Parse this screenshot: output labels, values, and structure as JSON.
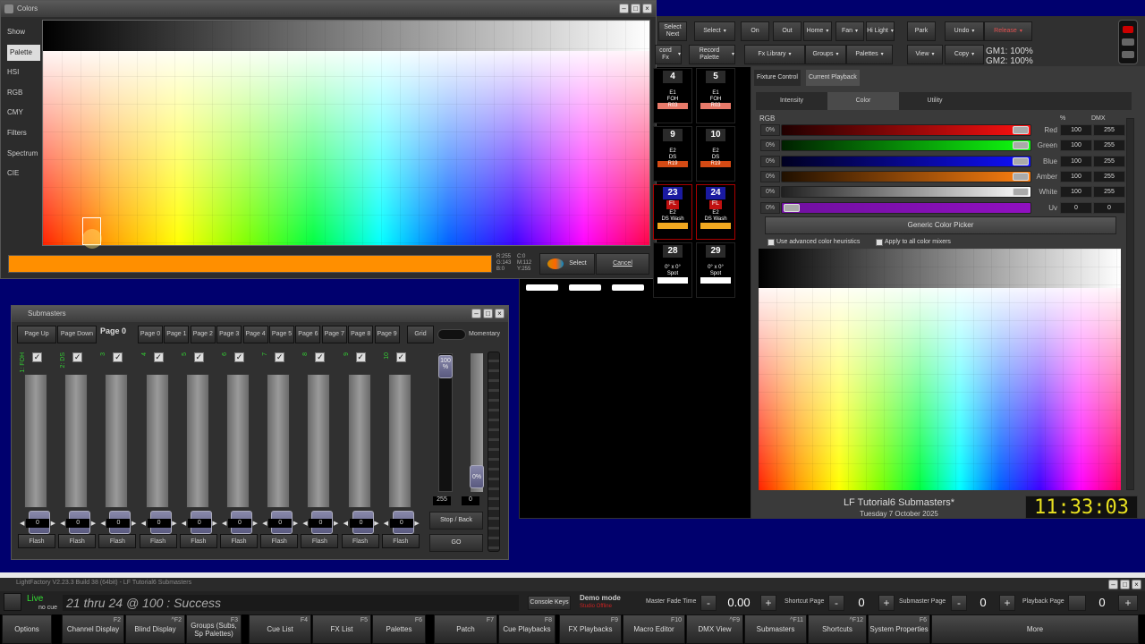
{
  "colors_window": {
    "title": "Colors",
    "sidebar": [
      "Show",
      "Palette",
      "HSI",
      "RGB",
      "CMY",
      "Filters",
      "Spectrum",
      "CIE"
    ],
    "selected_tab": "Palette",
    "readout": {
      "r": "R:255",
      "g": "G:143",
      "b": "B:0",
      "c": "C:0",
      "m": "M:112",
      "y": "Y:255"
    },
    "select_label": "Select",
    "cancel_label": "Cancel",
    "swatch_color": "#ff8f00"
  },
  "toolbar": {
    "row1": [
      {
        "label": "Select Next"
      },
      {
        "label": "Select",
        "drop": true
      },
      {
        "label": "On"
      },
      {
        "label": "Out"
      },
      {
        "label": "Home",
        "drop": true
      },
      {
        "label": "Fan",
        "drop": true
      },
      {
        "label": "Hi Light",
        "drop": true
      },
      {
        "label": "Park"
      },
      {
        "label": "Undo",
        "drop": true
      },
      {
        "label": "Release",
        "drop": true
      }
    ],
    "row2": [
      {
        "label": "cord Fx",
        "drop": true
      },
      {
        "label": "Record Palette",
        "drop": true
      },
      {
        "label": "Fx Library",
        "drop": true
      },
      {
        "label": "Groups",
        "drop": true
      },
      {
        "label": "Palettes",
        "drop": true
      },
      {
        "label": "View",
        "drop": true
      },
      {
        "label": "Copy",
        "drop": true
      }
    ],
    "gm1": "GM1: 100%",
    "gm2": "GM2: 100%"
  },
  "fixtures": [
    {
      "num": "4",
      "line1": "E1",
      "line2": "FOH",
      "tag": "R03",
      "tagcolor": "#e87a6a"
    },
    {
      "num": "5",
      "line1": "E1",
      "line2": "FOH",
      "tag": "R03",
      "tagcolor": "#e87a6a"
    },
    {
      "num": "9",
      "line1": "E2",
      "line2": "DS",
      "tag": "R19",
      "tagcolor": "#d44a14"
    },
    {
      "num": "10",
      "line1": "E2",
      "line2": "DS",
      "tag": "R19",
      "tagcolor": "#d44a14"
    },
    {
      "num": "23",
      "fl": "FL",
      "line1": "E2",
      "line2": "DS Wash",
      "tag": "",
      "tagcolor": "#f0a820"
    },
    {
      "num": "24",
      "fl": "FL",
      "line1": "E2",
      "line2": "DS Wash",
      "tag": "",
      "tagcolor": "#f0a820"
    },
    {
      "num": "28",
      "line1": "0° x 0°",
      "line2": "Spot",
      "tag": "",
      "tagcolor": "#fff"
    },
    {
      "num": "29",
      "line1": "0° x 0°",
      "line2": "Spot",
      "tag": "",
      "tagcolor": "#fff"
    }
  ],
  "fixture_control": {
    "tabs": [
      "Fixture Control",
      "Current Playback"
    ],
    "subtabs": [
      "Intensity",
      "Color",
      "Utility"
    ],
    "section": "RGB",
    "pct_header": "%",
    "dmx_header": "DMX",
    "rows": [
      {
        "name": "Red",
        "pct": "0%",
        "val": "100",
        "dmx": "255",
        "grad": "linear-gradient(90deg,#200000,#ff1010)"
      },
      {
        "name": "Green",
        "pct": "0%",
        "val": "100",
        "dmx": "255",
        "grad": "linear-gradient(90deg,#002000,#10ff10)"
      },
      {
        "name": "Blue",
        "pct": "0%",
        "val": "100",
        "dmx": "255",
        "grad": "linear-gradient(90deg,#000020,#1010ff)"
      },
      {
        "name": "Amber",
        "pct": "0%",
        "val": "100",
        "dmx": "255",
        "grad": "linear-gradient(90deg,#201000,#ff8010)"
      },
      {
        "name": "White",
        "pct": "0%",
        "val": "100",
        "dmx": "255",
        "grad": "linear-gradient(90deg,#202020,#ffffff)"
      },
      {
        "name": "Uv",
        "pct": "0%",
        "val": "0",
        "dmx": "0",
        "grad": "linear-gradient(90deg,#7010a0,#9010c0)"
      }
    ],
    "picker_label": "Generic Color Picker",
    "opt1": "Use advanced color heuristics",
    "opt2": "Apply to all color mixers"
  },
  "show_info": {
    "name": "LF Tutorial6 Submasters*",
    "date": "Tuesday 7 October  2025",
    "clock": "11:33:03"
  },
  "submasters": {
    "title": "Submasters",
    "page_up": "Page Up",
    "page_down": "Page Down",
    "current_page": "Page 0",
    "pages": [
      "Page 0",
      "Page 1",
      "Page 2",
      "Page 3",
      "Page 4",
      "Page 5",
      "Page 6",
      "Page 7",
      "Page 8",
      "Page 9"
    ],
    "grid": "Grid",
    "momentary": "Momentary",
    "faders": [
      {
        "label": "1: FOH",
        "pct": "0%",
        "val": "0"
      },
      {
        "label": "2: DS",
        "pct": "0%",
        "val": "0"
      },
      {
        "label": "3",
        "pct": "0%",
        "val": "0"
      },
      {
        "label": "4",
        "pct": "0%",
        "val": "0"
      },
      {
        "label": "5",
        "pct": "0%",
        "val": "0"
      },
      {
        "label": "6",
        "pct": "0%",
        "val": "0"
      },
      {
        "label": "7",
        "pct": "0%",
        "val": "0"
      },
      {
        "label": "8",
        "pct": "0%",
        "val": "0"
      },
      {
        "label": "9",
        "pct": "0%",
        "val": "0"
      },
      {
        "label": "10",
        "pct": "0%",
        "val": "0"
      }
    ],
    "flash": "Flash",
    "master_pct": "100 %",
    "master_val": "255",
    "second_pct": "0%",
    "second_val": "0",
    "stop_back": "Stop / Back",
    "go": "GO"
  },
  "app": {
    "title": "LightFactory V2.23.3 Build 38 (64bit) - LF Tutorial6 Submasters",
    "live": "Live",
    "nocue": "no cue",
    "command": "21 thru 24 @ 100 : Success",
    "console_keys": "Console Keys",
    "demo": "Demo mode",
    "demo_sub": "Studio Offline",
    "master_fade": "Master Fade Time",
    "fade_val": "0.00",
    "shortcut_page": "Shortcut Page",
    "shortcut_val": "0",
    "sub_page": "Submaster Page",
    "sub_val": "0",
    "pb_page": "Playback Page",
    "pb_val": "0"
  },
  "bottom_buttons": [
    {
      "label": "Options",
      "key": ""
    },
    {
      "label": "Channel Display",
      "key": "F2"
    },
    {
      "label": "Blind Display",
      "key": "^F2"
    },
    {
      "label": "Groups (Subs, Sp Palettes)",
      "key": "F3"
    },
    {
      "label": "Cue List",
      "key": "F4"
    },
    {
      "label": "FX List",
      "key": "F5"
    },
    {
      "label": "Palettes",
      "key": "F6"
    },
    {
      "label": "Patch",
      "key": "F7"
    },
    {
      "label": "Cue Playbacks",
      "key": "F8"
    },
    {
      "label": "FX Playbacks",
      "key": "F9"
    },
    {
      "label": "Macro Editor",
      "key": "F10"
    },
    {
      "label": "DMX View",
      "key": "^F9"
    },
    {
      "label": "Submasters",
      "key": "^F11"
    },
    {
      "label": "Shortcuts",
      "key": "^F12"
    },
    {
      "label": "System Properties",
      "key": "F6"
    },
    {
      "label": "More",
      "key": ""
    }
  ]
}
